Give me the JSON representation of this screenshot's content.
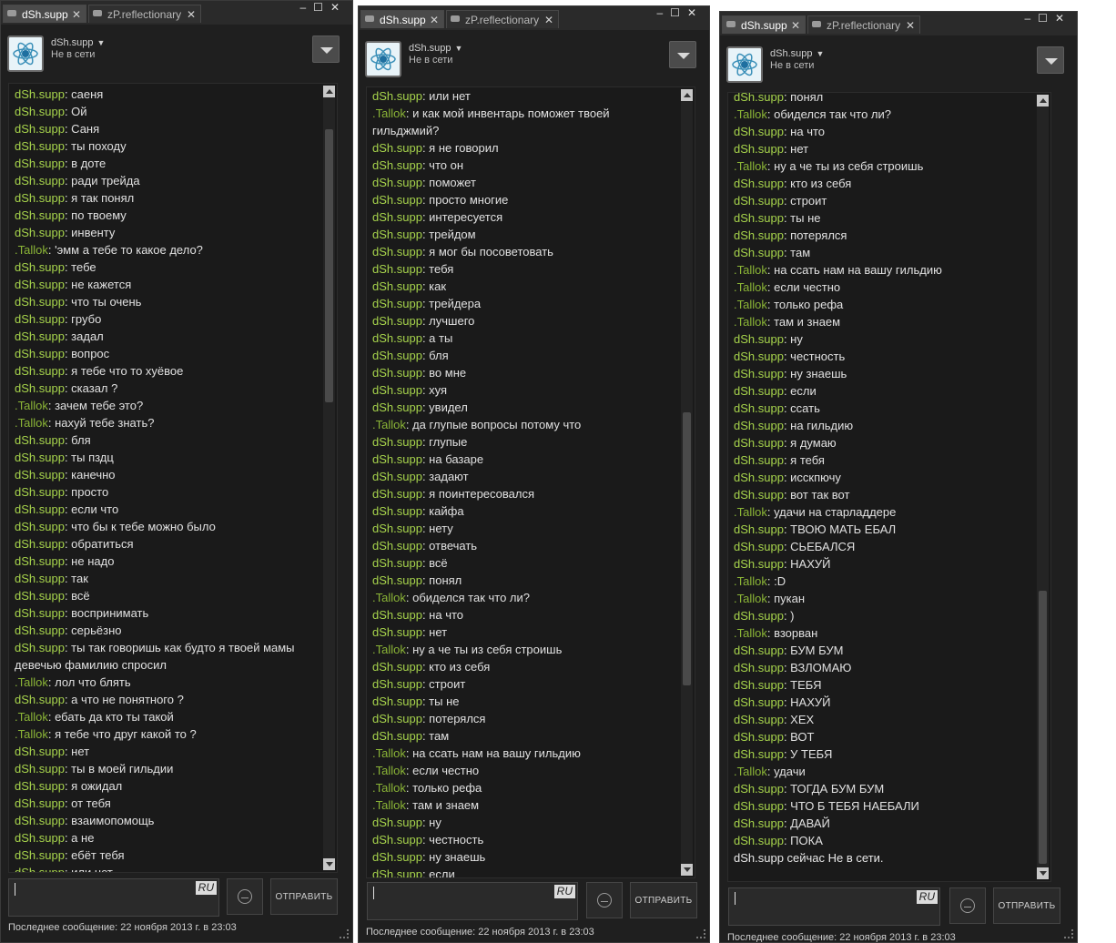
{
  "windows": [
    {
      "tabs": [
        "dSh.supp",
        "zP.reflectionary"
      ],
      "user": {
        "name": "dSh.supp",
        "status": "Не в сети"
      },
      "input": {
        "lang": "RU",
        "send": "ОТПРАВИТЬ"
      },
      "footer": "Последнее сообщение: 22 ноября 2013 г. в 23:03",
      "messages": [
        {
          "s": "dSh.supp",
          "t": "саеня"
        },
        {
          "s": "dSh.supp",
          "t": "Ой"
        },
        {
          "s": "dSh.supp",
          "t": "Саня"
        },
        {
          "s": "dSh.supp",
          "t": "ты походу"
        },
        {
          "s": "dSh.supp",
          "t": "в доте"
        },
        {
          "s": "dSh.supp",
          "t": "ради трейда"
        },
        {
          "s": "dSh.supp",
          "t": "я так понял"
        },
        {
          "s": "dSh.supp",
          "t": "по твоему"
        },
        {
          "s": "dSh.supp",
          "t": "инвенту"
        },
        {
          "s": ".Tallok",
          "t": "'эмм а тебе то какое дело?"
        },
        {
          "s": "dSh.supp",
          "t": "тебе"
        },
        {
          "s": "dSh.supp",
          "t": "не кажется"
        },
        {
          "s": "dSh.supp",
          "t": "что ты очень"
        },
        {
          "s": "dSh.supp",
          "t": "грубо"
        },
        {
          "s": "dSh.supp",
          "t": "задал"
        },
        {
          "s": "dSh.supp",
          "t": "вопрос"
        },
        {
          "s": "dSh.supp",
          "t": "я тебе что то хуёвое"
        },
        {
          "s": "dSh.supp",
          "t": "сказал ?"
        },
        {
          "s": ".Tallok",
          "t": "зачем тебе это?"
        },
        {
          "s": ".Tallok",
          "t": "нахуй тебе знать?"
        },
        {
          "s": "dSh.supp",
          "t": "бля"
        },
        {
          "s": "dSh.supp",
          "t": "ты пздц"
        },
        {
          "s": "dSh.supp",
          "t": "канечно"
        },
        {
          "s": "dSh.supp",
          "t": "просто"
        },
        {
          "s": "dSh.supp",
          "t": "если что"
        },
        {
          "s": "dSh.supp",
          "t": "что бы к тебе можно было"
        },
        {
          "s": "dSh.supp",
          "t": "обратиться"
        },
        {
          "s": "dSh.supp",
          "t": "не надо"
        },
        {
          "s": "dSh.supp",
          "t": "так"
        },
        {
          "s": "dSh.supp",
          "t": "всё"
        },
        {
          "s": "dSh.supp",
          "t": "воспринимать"
        },
        {
          "s": "dSh.supp",
          "t": "серьёзно"
        },
        {
          "s": "dSh.supp",
          "t": "ты так говоришь как будто я твоей мамы девечью фамилию спросил"
        },
        {
          "s": ".Tallok",
          "t": "лол что блять"
        },
        {
          "s": "dSh.supp",
          "t": "а что не понятного ?"
        },
        {
          "s": ".Tallok",
          "t": "ебать да кто ты такой"
        },
        {
          "s": ".Tallok",
          "t": "я тебе что друг какой то ?"
        },
        {
          "s": "dSh.supp",
          "t": "нет"
        },
        {
          "s": "dSh.supp",
          "t": "ты в моей гильдии"
        },
        {
          "s": "dSh.supp",
          "t": "я ожидал"
        },
        {
          "s": "dSh.supp",
          "t": "от тебя"
        },
        {
          "s": "dSh.supp",
          "t": "взаимопомощь"
        },
        {
          "s": "dSh.supp",
          "t": "а не"
        },
        {
          "s": "dSh.supp",
          "t": "ебёт тебя"
        },
        {
          "s": "dSh.supp",
          "t": "или нет"
        }
      ]
    },
    {
      "tabs": [
        "dSh.supp",
        "zP.reflectionary"
      ],
      "user": {
        "name": "dSh.supp",
        "status": "Не в сети"
      },
      "input": {
        "lang": "RU",
        "send": "ОТПРАВИТЬ"
      },
      "footer": "Последнее сообщение: 22 ноября 2013 г. в 23:03",
      "messages": [
        {
          "s": "dSh.supp",
          "t": "или нет"
        },
        {
          "s": ".Tallok",
          "t": "и как мой инвентарь поможет твоей гильджмий?"
        },
        {
          "s": "dSh.supp",
          "t": "я не говорил"
        },
        {
          "s": "dSh.supp",
          "t": "что он"
        },
        {
          "s": "dSh.supp",
          "t": "поможет"
        },
        {
          "s": "dSh.supp",
          "t": "просто многие"
        },
        {
          "s": "dSh.supp",
          "t": "интересуется"
        },
        {
          "s": "dSh.supp",
          "t": "трейдом"
        },
        {
          "s": "dSh.supp",
          "t": "я мог бы посоветовать"
        },
        {
          "s": "dSh.supp",
          "t": "тебя"
        },
        {
          "s": "dSh.supp",
          "t": "как"
        },
        {
          "s": "dSh.supp",
          "t": "трейдера"
        },
        {
          "s": "dSh.supp",
          "t": "лучшего"
        },
        {
          "s": "dSh.supp",
          "t": "а ты"
        },
        {
          "s": "dSh.supp",
          "t": "бля"
        },
        {
          "s": "dSh.supp",
          "t": "во мне"
        },
        {
          "s": "dSh.supp",
          "t": "хуя"
        },
        {
          "s": "dSh.supp",
          "t": "увидел"
        },
        {
          "s": ".Tallok",
          "t": "да глупые вопросы потому что"
        },
        {
          "s": "dSh.supp",
          "t": "глупые"
        },
        {
          "s": "dSh.supp",
          "t": "на базаре"
        },
        {
          "s": "dSh.supp",
          "t": "задают"
        },
        {
          "s": "dSh.supp",
          "t": "я поинтересовался"
        },
        {
          "s": "dSh.supp",
          "t": "кайфа"
        },
        {
          "s": "dSh.supp",
          "t": "нету"
        },
        {
          "s": "dSh.supp",
          "t": "отвечать"
        },
        {
          "s": "dSh.supp",
          "t": "всё"
        },
        {
          "s": "dSh.supp",
          "t": "понял"
        },
        {
          "s": ".Tallok",
          "t": "обиделся так что ли?"
        },
        {
          "s": "dSh.supp",
          "t": "на что"
        },
        {
          "s": "dSh.supp",
          "t": "нет"
        },
        {
          "s": ".Tallok",
          "t": "ну а че ты из себя строишь"
        },
        {
          "s": "dSh.supp",
          "t": "кто из себя"
        },
        {
          "s": "dSh.supp",
          "t": "строит"
        },
        {
          "s": "dSh.supp",
          "t": "ты не"
        },
        {
          "s": "dSh.supp",
          "t": "потерялся"
        },
        {
          "s": "dSh.supp",
          "t": "там"
        },
        {
          "s": ".Tallok",
          "t": "на ссать нам на вашу гильдию"
        },
        {
          "s": ".Tallok",
          "t": "если честно"
        },
        {
          "s": ".Tallok",
          "t": "только рефа"
        },
        {
          "s": ".Tallok",
          "t": "там и знаем"
        },
        {
          "s": "dSh.supp",
          "t": "ну"
        },
        {
          "s": "dSh.supp",
          "t": "честность"
        },
        {
          "s": "dSh.supp",
          "t": "ну знаешь"
        },
        {
          "s": "dSh.supp",
          "t": "если"
        }
      ]
    },
    {
      "tabs": [
        "dSh.supp",
        "zP.reflectionary"
      ],
      "user": {
        "name": "dSh.supp",
        "status": "Не в сети"
      },
      "input": {
        "lang": "RU",
        "send": "ОТПРАВИТЬ"
      },
      "footer": "Последнее сообщение: 22 ноября 2013 г. в 23:03",
      "offline_notice": "dSh.supp сейчас Не в сети.",
      "messages": [
        {
          "s": "dSh.supp",
          "t": "понял"
        },
        {
          "s": ".Tallok",
          "t": "обиделся так что ли?"
        },
        {
          "s": "dSh.supp",
          "t": "на что"
        },
        {
          "s": "dSh.supp",
          "t": "нет"
        },
        {
          "s": ".Tallok",
          "t": "ну а че ты из себя строишь"
        },
        {
          "s": "dSh.supp",
          "t": "кто из себя"
        },
        {
          "s": "dSh.supp",
          "t": "строит"
        },
        {
          "s": "dSh.supp",
          "t": "ты не"
        },
        {
          "s": "dSh.supp",
          "t": "потерялся"
        },
        {
          "s": "dSh.supp",
          "t": "там"
        },
        {
          "s": ".Tallok",
          "t": "на ссать нам на вашу гильдию"
        },
        {
          "s": ".Tallok",
          "t": "если честно"
        },
        {
          "s": ".Tallok",
          "t": "только рефа"
        },
        {
          "s": ".Tallok",
          "t": "там и знаем"
        },
        {
          "s": "dSh.supp",
          "t": "ну"
        },
        {
          "s": "dSh.supp",
          "t": "честность"
        },
        {
          "s": "dSh.supp",
          "t": "ну знаешь"
        },
        {
          "s": "dSh.supp",
          "t": "если"
        },
        {
          "s": "dSh.supp",
          "t": "ссать"
        },
        {
          "s": "dSh.supp",
          "t": "на гильдию"
        },
        {
          "s": "dSh.supp",
          "t": "я думаю"
        },
        {
          "s": "dSh.supp",
          "t": "я тебя"
        },
        {
          "s": "dSh.supp",
          "t": "исскпючу"
        },
        {
          "s": "dSh.supp",
          "t": "вот так вот"
        },
        {
          "s": ".Tallok",
          "t": "удачи на старладдере"
        },
        {
          "s": "dSh.supp",
          "t": "ТВОЮ МАТЬ ЕБАЛ"
        },
        {
          "s": "dSh.supp",
          "t": "СЬЕБАЛСЯ"
        },
        {
          "s": "dSh.supp",
          "t": "НАХУЙ"
        },
        {
          "s": ".Tallok",
          "t": ":D"
        },
        {
          "s": ".Tallok",
          "t": "пукан"
        },
        {
          "s": "dSh.supp",
          "t": ")"
        },
        {
          "s": ".Tallok",
          "t": "взорван"
        },
        {
          "s": "dSh.supp",
          "t": "БУМ БУМ"
        },
        {
          "s": "dSh.supp",
          "t": "ВЗЛОМАЮ"
        },
        {
          "s": "dSh.supp",
          "t": "ТЕБЯ"
        },
        {
          "s": "dSh.supp",
          "t": "НАХУЙ"
        },
        {
          "s": "dSh.supp",
          "t": "ХЕХ"
        },
        {
          "s": "dSh.supp",
          "t": "ВОТ"
        },
        {
          "s": "dSh.supp",
          "t": "У ТЕБЯ"
        },
        {
          "s": ".Tallok",
          "t": "удачи"
        },
        {
          "s": "dSh.supp",
          "t": "ТОГДА БУМ БУМ"
        },
        {
          "s": "dSh.supp",
          "t": "ЧТО Б ТЕБЯ НАЕБАЛИ"
        },
        {
          "s": "dSh.supp",
          "t": "ДАВАЙ"
        },
        {
          "s": "dSh.supp",
          "t": "ПОКА"
        }
      ]
    }
  ]
}
